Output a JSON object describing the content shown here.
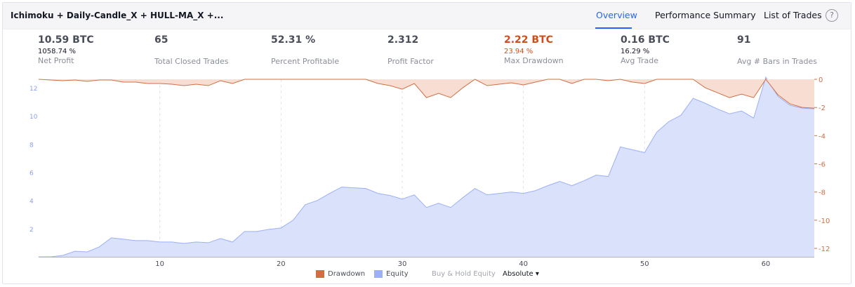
{
  "header": {
    "title": "Ichimoku + Daily-Candle_X + HULL-MA_X +...",
    "tabs": [
      "Overview",
      "Performance Summary",
      "List of Trades"
    ],
    "active_tab": "Overview",
    "help": "?"
  },
  "stats": {
    "net_profit": {
      "value": "10.59 BTC",
      "sub": "1058.74 %",
      "label": "Net Profit"
    },
    "total_closed_trades": {
      "value": "65",
      "label": "Total Closed Trades"
    },
    "percent_profitable": {
      "value": "52.31 %",
      "label": "Percent Profitable"
    },
    "profit_factor": {
      "value": "2.312",
      "label": "Profit Factor"
    },
    "max_drawdown": {
      "value": "2.22 BTC",
      "sub": "23.94 %",
      "label": "Max Drawdown"
    },
    "avg_trade": {
      "value": "0.16 BTC",
      "sub": "16.29 %",
      "label": "Avg Trade"
    },
    "avg_bars": {
      "value": "91",
      "label": "Avg # Bars in Trades"
    }
  },
  "legend": {
    "drawdown": "Drawdown",
    "equity": "Equity",
    "buy_hold": "Buy & Hold Equity",
    "mode": "Absolute"
  },
  "colors": {
    "drawdown_line": "#d06f45",
    "drawdown_fill": "#f8ddd2",
    "equity_line": "#9bb0f7",
    "equity_fill": "#dae1fb",
    "accent": "#2962ff",
    "max_drawdown_text": "#cf4d18"
  },
  "chart_data": {
    "type": "area",
    "x_ticks": [
      10,
      20,
      30,
      40,
      50,
      60
    ],
    "xlim": [
      0,
      64
    ],
    "left_axis": {
      "ticks": [
        2,
        4,
        6,
        8,
        10,
        12
      ],
      "ylim": [
        0,
        12.6
      ]
    },
    "right_axis": {
      "ticks": [
        0,
        -2,
        -4,
        -6,
        -8,
        -10,
        -12
      ],
      "ylim": [
        -12.6,
        0
      ]
    },
    "series": [
      {
        "name": "Equity",
        "axis": "left",
        "x": [
          0,
          1,
          2,
          3,
          4,
          5,
          6,
          7,
          8,
          9,
          10,
          11,
          12,
          13,
          14,
          15,
          16,
          17,
          18,
          19,
          20,
          21,
          22,
          23,
          24,
          25,
          26,
          27,
          28,
          29,
          30,
          31,
          32,
          33,
          34,
          35,
          36,
          37,
          38,
          39,
          40,
          41,
          42,
          43,
          44,
          45,
          46,
          47,
          48,
          49,
          50,
          51,
          52,
          53,
          54,
          55,
          56,
          57,
          58,
          59,
          60,
          61,
          62,
          63,
          64
        ],
        "values": [
          0,
          0,
          0.1,
          0.4,
          0.35,
          0.7,
          1.35,
          1.25,
          1.15,
          1.15,
          1.05,
          1.05,
          0.95,
          1.05,
          1.0,
          1.3,
          1.05,
          1.8,
          1.8,
          1.95,
          2.05,
          2.6,
          3.7,
          4.0,
          4.5,
          4.95,
          4.9,
          4.85,
          4.5,
          4.35,
          4.1,
          4.4,
          3.5,
          3.8,
          3.5,
          4.2,
          4.85,
          4.4,
          4.5,
          4.6,
          4.5,
          4.7,
          5.05,
          5.35,
          5.05,
          5.4,
          5.8,
          5.7,
          7.8,
          7.6,
          7.4,
          8.85,
          9.6,
          10.05,
          11.25,
          10.9,
          10.5,
          10.15,
          10.35,
          9.85,
          12.75,
          11.4,
          10.75,
          10.55,
          10.5
        ]
      },
      {
        "name": "Drawdown",
        "axis": "right",
        "x": [
          0,
          1,
          2,
          3,
          4,
          5,
          6,
          7,
          8,
          9,
          10,
          11,
          12,
          13,
          14,
          15,
          16,
          17,
          18,
          19,
          20,
          21,
          22,
          23,
          24,
          25,
          26,
          27,
          28,
          29,
          30,
          31,
          32,
          33,
          34,
          35,
          36,
          37,
          38,
          39,
          40,
          41,
          42,
          43,
          44,
          45,
          46,
          47,
          48,
          49,
          50,
          51,
          52,
          53,
          54,
          55,
          56,
          57,
          58,
          59,
          60,
          61,
          62,
          63,
          64
        ],
        "values": [
          0,
          -0.05,
          -0.1,
          -0.05,
          -0.15,
          -0.05,
          -0.05,
          -0.2,
          -0.2,
          -0.3,
          -0.3,
          -0.35,
          -0.45,
          -0.35,
          -0.45,
          -0.1,
          -0.3,
          0,
          0,
          0,
          0,
          0,
          0,
          0,
          0,
          0,
          0,
          0,
          -0.3,
          -0.45,
          -0.7,
          -0.3,
          -1.3,
          -1.0,
          -1.3,
          -0.6,
          0,
          -0.45,
          -0.35,
          -0.25,
          -0.4,
          -0.2,
          0,
          0,
          -0.3,
          0,
          0,
          -0.1,
          0,
          -0.2,
          -0.3,
          0,
          0,
          0,
          0,
          -0.6,
          -0.95,
          -1.3,
          -1.05,
          -1.3,
          0,
          -1.1,
          -1.75,
          -2.0,
          -2.05
        ]
      }
    ]
  }
}
